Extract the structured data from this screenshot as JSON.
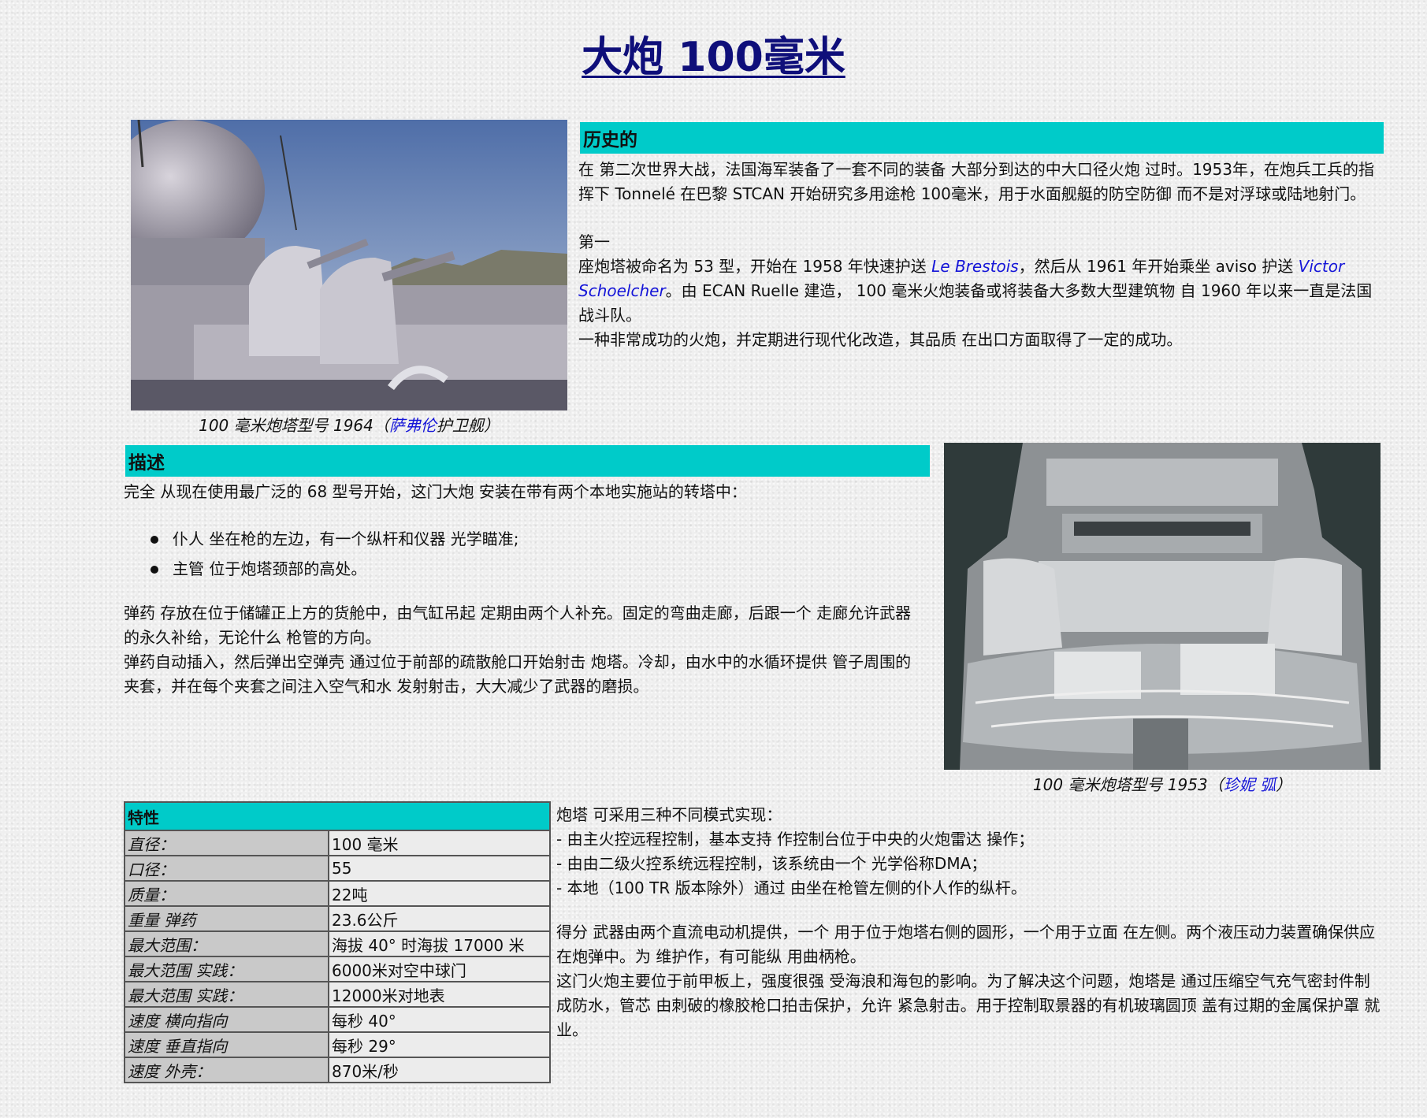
{
  "title": "大炮 100毫米",
  "history": {
    "heading": "历史的",
    "p1": "在 第二次世界大战，法国海军装备了一套不同的装备 大部分到达的中大口径火炮 过时。1953年，在炮兵工兵的指挥下 Tonnelé 在巴黎 STCAN 开始研究多用途枪 100毫米，用于水面舰艇的防空防御 而不是对浮球或陆地射门。",
    "p2_a": "第一",
    "p2_b": "座炮塔被命名为 53 型，开始在 1958 年快速护送 ",
    "p2_link1": "Le Brestois",
    "p2_c": "，然后从 1961 年开始乘坐 aviso 护送 ",
    "p2_link2": "Victor Schoelcher",
    "p2_d": "。由 ECAN Ruelle 建造， 100 毫米火炮装备或将装备大多数大型建筑物 自 1960 年以来一直是法国战斗队。",
    "p3": "一种非常成功的火炮，并定期进行现代化改造，其品质 在出口方面取得了一定的成功。"
  },
  "photo1": {
    "caption_a": "100 毫米炮塔型号 1964（",
    "caption_link": "萨弗伦",
    "caption_b": "护卫舰）"
  },
  "description": {
    "heading": "描述",
    "intro": "完全 从现在使用最广泛的 68 型号开始，这门大炮 安装在带有两个本地实施站的转塔中：",
    "bullets": [
      "仆人 坐在枪的左边，有一个纵杆和仪器 光学瞄准;",
      "主管 位于炮塔颈部的高处。"
    ],
    "p1": "弹药 存放在位于储罐正上方的货舱中，由气缸吊起 定期由两个人补充。固定的弯曲走廊，后跟一个 走廊允许武器的永久补给，无论什么 枪管的方向。",
    "p2": "弹药自动插入，然后弹出空弹壳 通过位于前部的疏散舱口开始射击 炮塔。冷却，由水中的水循环提供 管子周围的夹套，并在每个夹套之间注入空气和水 发射射击，大大减少了武器的磨损。"
  },
  "photo2": {
    "caption_a": "100 毫米炮塔型号 1953（",
    "caption_link": "珍妮 弧",
    "caption_b": "）"
  },
  "specs": {
    "heading": "特性",
    "rows": [
      {
        "k": "直径：",
        "v": "100 毫米"
      },
      {
        "k": "口径：",
        "v": "55"
      },
      {
        "k": "质量：",
        "v": "22吨"
      },
      {
        "k": "重量 弹药",
        "v": "23.6公斤"
      },
      {
        "k": "最大范围：",
        "v": "海拔 40° 时海拔 17000 米"
      },
      {
        "k": "最大范围 实践：",
        "v": "6000米对空中球门"
      },
      {
        "k": "最大范围 实践：",
        "v": "12000米对地表"
      },
      {
        "k": "速度 横向指向",
        "v": "每秒 40°"
      },
      {
        "k": "速度 垂直指向",
        "v": "每秒 29°"
      },
      {
        "k": "速度 外壳：",
        "v": "870米/秒"
      }
    ]
  },
  "modes": {
    "l1": "炮塔 可采用三种不同模式实现：",
    "l2": "- 由主火控远程控制，基本支持 作控制台位于中央的火炮雷达 操作；",
    "l3": "- 由由二级火控系统远程控制，该系统由一个 光学俗称DMA；",
    "l4": "- 本地（100 TR 版本除外）通过 由坐在枪管左侧的仆人作的纵杆。",
    "p2": "得分 武器由两个直流电动机提供，一个 用于位于炮塔右侧的圆形，一个用于立面 在左侧。两个液压动力装置确保供应 在炮弹中。为 维护作，有可能纵 用曲柄枪。",
    "p3": "这门火炮主要位于前甲板上，强度很强 受海浪和海包的影响。为了解决这个问题，炮塔是 通过压缩空气充气密封件制成防水，管芯 由刺破的橡胶枪口拍击保护，允许 紧急射击。用于控制取景器的有机玻璃圆顶 盖有过期的金属保护罩 就业。"
  }
}
